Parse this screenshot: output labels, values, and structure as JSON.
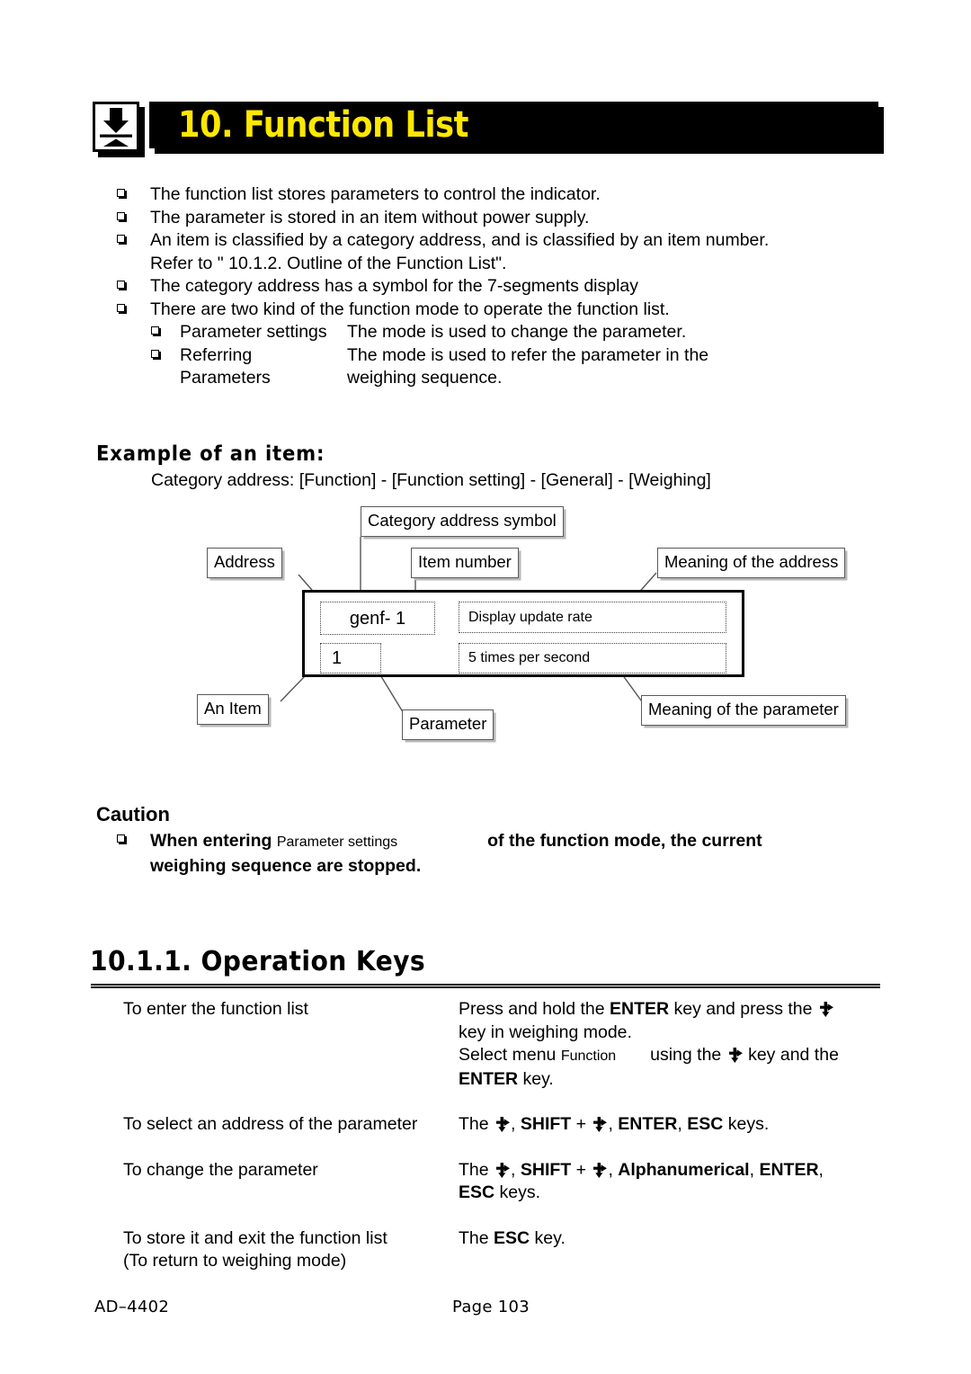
{
  "header": {
    "icon": "compression-weighing-icon",
    "title": "10. Function List",
    "bar_color": "#000000",
    "title_color": "#ffe800"
  },
  "intro_bullets": [
    "The function list stores parameters to control the indicator.",
    "The parameter is stored in an item without power supply.",
    "An item is classified by a category address, and is classified by an item number.",
    "The category address has a symbol for the 7-segments display",
    "There are two kind of the function mode to operate the function list."
  ],
  "intro_continuation": "Refer to \" 10.1.2. Outline of the Function List\".",
  "mode_sub_items": [
    {
      "label": "Parameter settings",
      "desc": "The mode is used to change the parameter."
    },
    {
      "label": "Referring Parameters",
      "desc_line1": "The mode is used to refer the parameter in the",
      "desc_line2": "weighing sequence."
    }
  ],
  "example": {
    "heading": "Example of an item:",
    "category_address": "Category address: [Function] - [Function setting] - [General] - [Weighing]",
    "callouts": {
      "category_address_symbol": "Category address symbol",
      "address": "Address",
      "item_number": "Item number",
      "meaning_of_the_address": "Meaning of the address",
      "an_item": "An Item",
      "parameter": "Parameter",
      "meaning_of_the_parameter": "Meaning of the parameter"
    },
    "item_box": {
      "address_value": "genf- 1",
      "address_meaning": "Display update rate",
      "parameter_value": "1",
      "parameter_meaning": "5 times per second"
    }
  },
  "caution": {
    "heading": "Caution",
    "text_a": "When entering",
    "text_small": "Parameter settings",
    "text_b": "of the function mode, the   current",
    "text_line2": "weighing  sequence are stopped."
  },
  "operation_keys": {
    "heading": "10.1.1.    Operation Keys",
    "rows": [
      {
        "action": "To enter the function list",
        "lines": [
          {
            "segments": [
              {
                "t": "Press and hold the ",
                "b": false
              },
              {
                "t": "ENTER",
                "b": true
              },
              {
                "t": " key and press the ",
                "b": false
              },
              {
                "t": "",
                "icon": "nav-key-icon"
              }
            ]
          },
          {
            "segments": [
              {
                "t": "key in weighing mode.",
                "b": false
              }
            ]
          },
          {
            "segments": [
              {
                "t": "Select menu ",
                "b": false
              },
              {
                "t": "Function",
                "small": true
              },
              {
                "t": "       using the ",
                "b": false
              },
              {
                "t": "",
                "icon": "nav-key-icon"
              },
              {
                "t": " key and the",
                "b": false
              }
            ]
          },
          {
            "segments": [
              {
                "t": "ENTER",
                "b": true
              },
              {
                "t": " key.",
                "b": false
              }
            ]
          }
        ]
      },
      {
        "action": "To select an address of the parameter",
        "lines": [
          {
            "segments": [
              {
                "t": "The ",
                "b": false
              },
              {
                "t": "",
                "icon": "nav-key-icon"
              },
              {
                "t": ", ",
                "b": false
              },
              {
                "t": "SHIFT",
                "b": true
              },
              {
                "t": " + ",
                "b": false
              },
              {
                "t": "",
                "icon": "nav-key-icon"
              },
              {
                "t": ", ",
                "b": false
              },
              {
                "t": "ENTER",
                "b": true
              },
              {
                "t": ", ",
                "b": false
              },
              {
                "t": "ESC",
                "b": true
              },
              {
                "t": " keys.",
                "b": false
              }
            ]
          }
        ]
      },
      {
        "action": "To change the parameter",
        "lines": [
          {
            "segments": [
              {
                "t": "The ",
                "b": false
              },
              {
                "t": "",
                "icon": "nav-key-icon"
              },
              {
                "t": ", ",
                "b": false
              },
              {
                "t": "SHIFT",
                "b": true
              },
              {
                "t": " + ",
                "b": false
              },
              {
                "t": "",
                "icon": "nav-key-icon"
              },
              {
                "t": ", ",
                "b": false
              },
              {
                "t": "Alphanumerical",
                "b": true
              },
              {
                "t": ", ",
                "b": false
              },
              {
                "t": "ENTER",
                "b": true
              },
              {
                "t": ",",
                "b": false
              }
            ]
          },
          {
            "segments": [
              {
                "t": "ESC",
                "b": true
              },
              {
                "t": " keys.",
                "b": false
              }
            ]
          }
        ]
      },
      {
        "action": "To store it and exit the function list",
        "action_line2": "(To return to weighing mode)",
        "lines": [
          {
            "segments": [
              {
                "t": "The ",
                "b": false
              },
              {
                "t": "ESC",
                "b": true
              },
              {
                "t": " key.",
                "b": false
              }
            ]
          }
        ]
      }
    ]
  },
  "footer": {
    "model": "AD–4402",
    "page": "Page 103"
  }
}
